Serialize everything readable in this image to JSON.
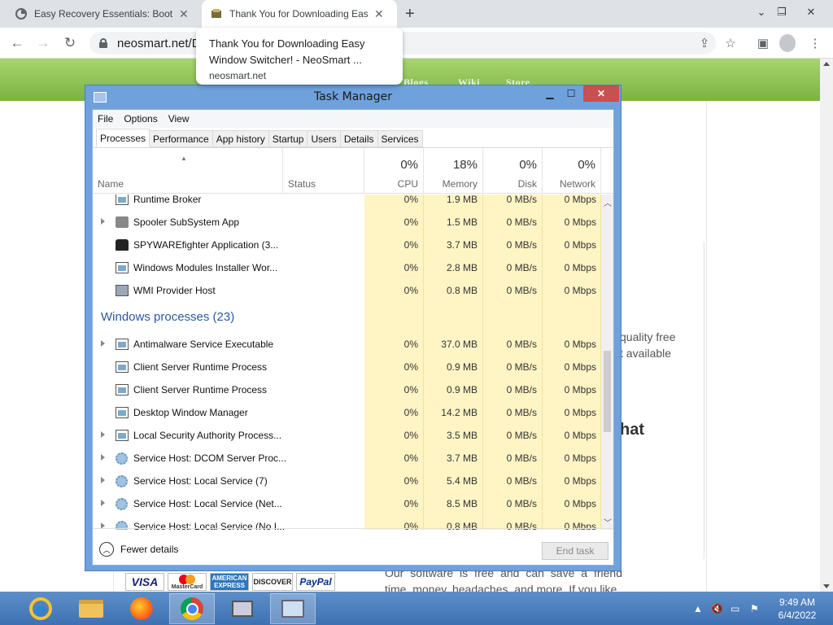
{
  "browser": {
    "tabs": [
      {
        "title": "Easy Recovery Essentials: Bootab",
        "icon": "neosmart-icon"
      },
      {
        "title": "Thank You for Downloading Easy",
        "icon": "window-switcher-icon"
      }
    ],
    "new_tab_label": "+",
    "url": "neosmart.net/D",
    "hover_card": {
      "title_line1": "Thank You for Downloading Easy",
      "title_line2": "Window Switcher! - NeoSmart ...",
      "domain": "neosmart.net"
    }
  },
  "site": {
    "nav": [
      "Blogs",
      "Wiki",
      "Store"
    ],
    "text_line1": "quality free",
    "text_line2": "t available",
    "heading_fragment": "hat",
    "body_text": "Our software is free and can save a friend time, money, headaches, and more. If you like",
    "payment_logos": [
      "VISA",
      "MasterCard",
      "AMERICAN EXPRESS",
      "DISCOVER",
      "PayPal"
    ],
    "accent_color": "#7cb342"
  },
  "task_manager": {
    "title": "Task Manager",
    "menu": [
      "File",
      "Options",
      "View"
    ],
    "tabs": [
      "Processes",
      "Performance",
      "App history",
      "Startup",
      "Users",
      "Details",
      "Services"
    ],
    "active_tab": "Processes",
    "columns": {
      "name": "Name",
      "status": "Status",
      "cpu": {
        "pct": "0%",
        "label": "CPU"
      },
      "memory": {
        "pct": "18%",
        "label": "Memory"
      },
      "disk": {
        "pct": "0%",
        "label": "Disk"
      },
      "network": {
        "pct": "0%",
        "label": "Network"
      }
    },
    "background_rows": [
      {
        "name": "Runtime Broker",
        "icon": "window-icon",
        "expander": false,
        "cpu": "0%",
        "mem": "1.9 MB",
        "disk": "0 MB/s",
        "net": "0 Mbps"
      },
      {
        "name": "Spooler SubSystem App",
        "icon": "printer-icon",
        "expander": true,
        "cpu": "0%",
        "mem": "1.5 MB",
        "disk": "0 MB/s",
        "net": "0 Mbps"
      },
      {
        "name": "SPYWAREfighter Application (3...",
        "icon": "spy-icon",
        "expander": false,
        "cpu": "0%",
        "mem": "3.7 MB",
        "disk": "0 MB/s",
        "net": "0 Mbps"
      },
      {
        "name": "Windows Modules Installer Wor...",
        "icon": "window-icon",
        "expander": false,
        "cpu": "0%",
        "mem": "2.8 MB",
        "disk": "0 MB/s",
        "net": "0 Mbps"
      },
      {
        "name": "WMI Provider Host",
        "icon": "wmi-icon",
        "expander": false,
        "cpu": "0%",
        "mem": "0.8 MB",
        "disk": "0 MB/s",
        "net": "0 Mbps"
      }
    ],
    "group_title": "Windows processes (23)",
    "windows_rows": [
      {
        "name": "Antimalware Service Executable",
        "icon": "window-icon",
        "expander": true,
        "cpu": "0%",
        "mem": "37.0 MB",
        "disk": "0 MB/s",
        "net": "0 Mbps"
      },
      {
        "name": "Client Server Runtime Process",
        "icon": "window-icon",
        "expander": false,
        "cpu": "0%",
        "mem": "0.9 MB",
        "disk": "0 MB/s",
        "net": "0 Mbps"
      },
      {
        "name": "Client Server Runtime Process",
        "icon": "window-icon",
        "expander": false,
        "cpu": "0%",
        "mem": "0.9 MB",
        "disk": "0 MB/s",
        "net": "0 Mbps"
      },
      {
        "name": "Desktop Window Manager",
        "icon": "window-icon",
        "expander": false,
        "cpu": "0%",
        "mem": "14.2 MB",
        "disk": "0 MB/s",
        "net": "0 Mbps"
      },
      {
        "name": "Local Security Authority Process...",
        "icon": "window-icon",
        "expander": true,
        "cpu": "0%",
        "mem": "3.5 MB",
        "disk": "0 MB/s",
        "net": "0 Mbps"
      },
      {
        "name": "Service Host: DCOM Server Proc...",
        "icon": "gear-icon",
        "expander": true,
        "cpu": "0%",
        "mem": "3.7 MB",
        "disk": "0 MB/s",
        "net": "0 Mbps"
      },
      {
        "name": "Service Host: Local Service (7)",
        "icon": "gear-icon",
        "expander": true,
        "cpu": "0%",
        "mem": "5.4 MB",
        "disk": "0 MB/s",
        "net": "0 Mbps"
      },
      {
        "name": "Service Host: Local Service (Net...",
        "icon": "gear-icon",
        "expander": true,
        "cpu": "0%",
        "mem": "8.5 MB",
        "disk": "0 MB/s",
        "net": "0 Mbps"
      },
      {
        "name": "Service Host: Local Service (No I...",
        "icon": "gear-icon",
        "expander": true,
        "cpu": "0%",
        "mem": "0.8 MB",
        "disk": "0 MB/s",
        "net": "0 Mbps"
      }
    ],
    "fewer_details": "Fewer details",
    "end_task": "End task"
  },
  "taskbar": {
    "apps": [
      "internet-explorer-icon",
      "file-explorer-icon",
      "firefox-icon",
      "chrome-icon",
      "this-pc-icon",
      "task-manager-icon"
    ],
    "clock_time": "9:49 AM",
    "clock_date": "6/4/2022"
  }
}
